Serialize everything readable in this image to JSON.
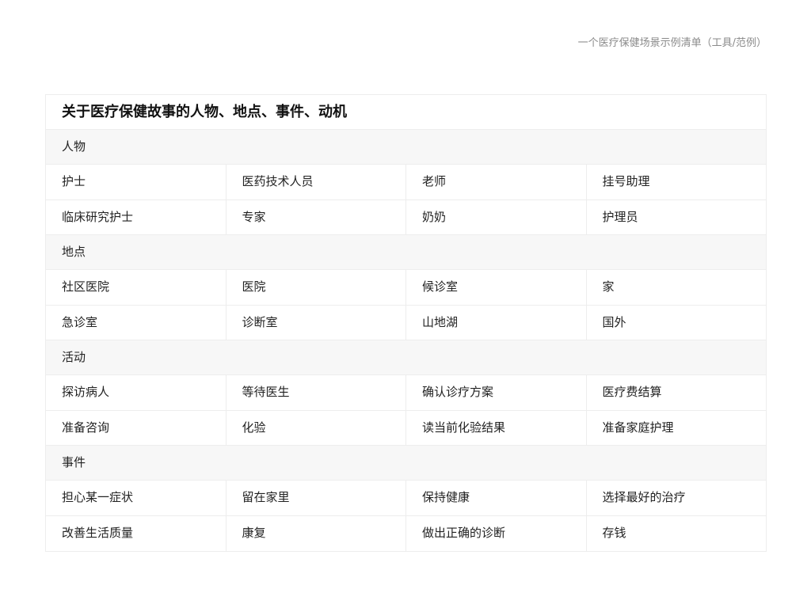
{
  "header": {
    "caption": "一个医疗保健场景示例清单（工具/范例）"
  },
  "table": {
    "title": "关于医疗保健故事的人物、地点、事件、动机",
    "sections": [
      {
        "heading": "人物",
        "rows": [
          [
            "护士",
            "医药技术人员",
            "老师",
            "挂号助理"
          ],
          [
            "临床研究护士",
            "专家",
            "奶奶",
            "护理员"
          ]
        ]
      },
      {
        "heading": "地点",
        "rows": [
          [
            "社区医院",
            "医院",
            "候诊室",
            "家"
          ],
          [
            "急诊室",
            "诊断室",
            "山地湖",
            "国外"
          ]
        ]
      },
      {
        "heading": "活动",
        "rows": [
          [
            "探访病人",
            "等待医生",
            "确认诊疗方案",
            "医疗费结算"
          ],
          [
            "准备咨询",
            "化验",
            "读当前化验结果",
            "准备家庭护理"
          ]
        ]
      },
      {
        "heading": "事件",
        "rows": [
          [
            "担心某一症状",
            "留在家里",
            "保持健康",
            "选择最好的治疗"
          ],
          [
            "改善生活质量",
            "康复",
            "做出正确的诊断",
            "存钱"
          ]
        ]
      }
    ]
  }
}
